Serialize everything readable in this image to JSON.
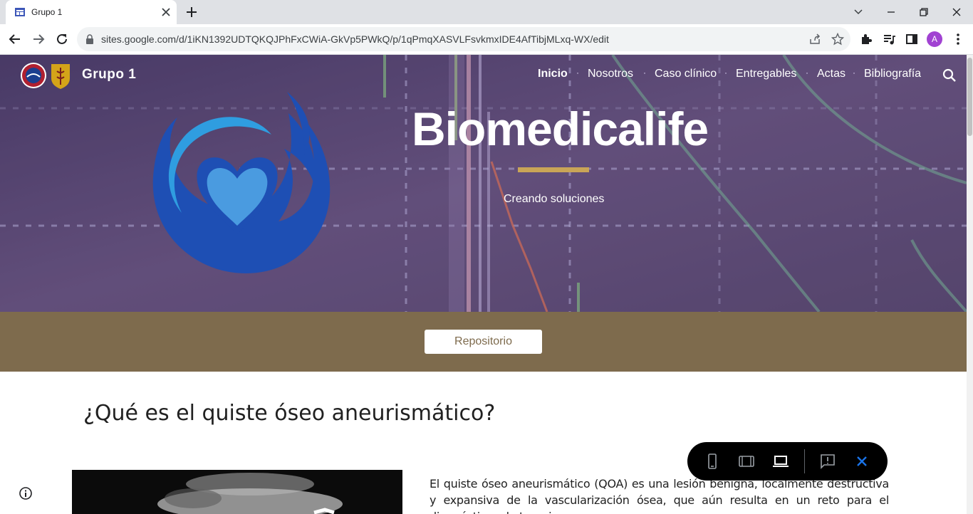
{
  "browser": {
    "tab_title": "Grupo 1",
    "url": "sites.google.com/d/1iKN1392UDTQKQJPhFxCWiA-GkVp5PWkQ/p/1qPmqXASVLFsvkmxIDE4AfTibjMLxq-WX/edit",
    "profile_initial": "A",
    "icons": [
      "site-favicon",
      "close-icon",
      "plus-icon",
      "chevron-down-icon",
      "minimize-icon",
      "restore-icon",
      "close-window-icon",
      "back-icon",
      "forward-icon",
      "reload-icon",
      "lock-icon",
      "share-icon",
      "star-icon",
      "extensions-icon",
      "media-icon",
      "side-panel-icon",
      "more-icon"
    ]
  },
  "site": {
    "title": "Grupo 1",
    "nav": [
      "Inicio",
      "Nosotros",
      "Caso clínico",
      "Entregables",
      "Actas",
      "Bibliografía"
    ],
    "active_nav": "Inicio",
    "hero_title": "Biomedicalife",
    "hero_subtitle": "Creando soluciones",
    "button_label": "Repositorio",
    "section_heading": "¿Qué es el quiste óseo aneurismático?",
    "paragraph": "El quiste óseo aneurismático (QOA) es una lesión benigna, localmente destructiva y expansiva de la vascularización ósea, que aún resulta en un reto para el diagnóstico y la terapia",
    "colors": {
      "band": "#7e6b4d",
      "accent_rule": "#c9a557",
      "hero_overlay": "#5b4a75",
      "logo_blue": "#1e4fb4",
      "logo_light_blue": "#2f9de0"
    }
  },
  "preview_toolbar": {
    "icons": [
      "phone-icon",
      "tablet-icon",
      "laptop-icon",
      "feedback-icon",
      "close-preview-icon"
    ]
  }
}
